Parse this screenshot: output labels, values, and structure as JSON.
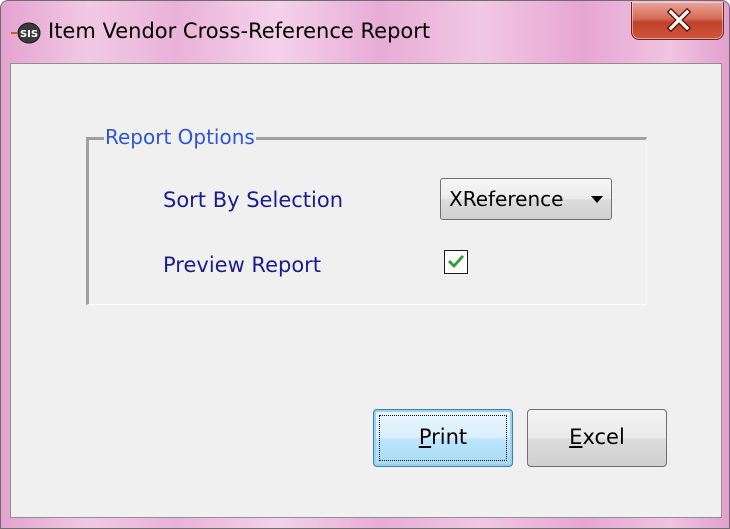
{
  "window": {
    "title": "Item Vendor Cross-Reference Report",
    "app_icon": "sis-app-icon",
    "close_icon": "close-x-icon"
  },
  "report_options": {
    "group_label": "Report Options",
    "sort_by": {
      "label": "Sort By Selection",
      "selected": "XReference"
    },
    "preview": {
      "label": "Preview Report",
      "checked": true
    }
  },
  "buttons": {
    "print": {
      "accel": "P",
      "rest": "rint"
    },
    "excel": {
      "accel": "E",
      "rest": "xcel"
    }
  },
  "colors": {
    "titlebar": "#e8b0d6",
    "legend_text": "#2f55d4",
    "label_text": "#1c1c8c",
    "checkmark": "#2e9a2e",
    "close_button": "#c7432d"
  }
}
